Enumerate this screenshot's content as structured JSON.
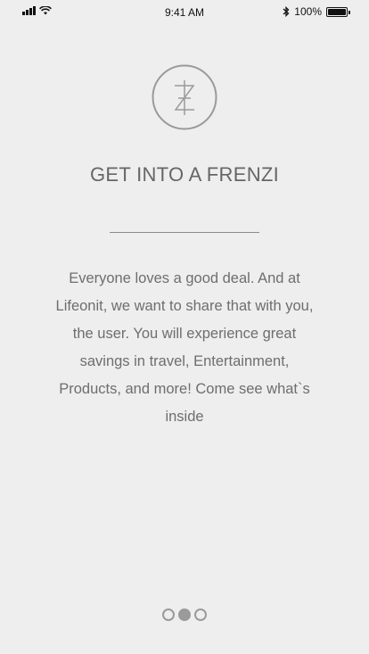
{
  "status_bar": {
    "time": "9:41 AM",
    "battery_text": "100%",
    "icons": [
      "signal-icon",
      "wifi-icon",
      "bluetooth-icon",
      "battery-icon"
    ]
  },
  "logo": {
    "icon": "frenzi-logo-icon",
    "color": "#9a9a9a"
  },
  "title": "GET INTO A FRENZI",
  "body": "Everyone loves a good deal. And at Lifeonit, we want to share that with you, the user. You will experience great savings in travel, Entertainment, Products, and more! Come see what`s inside",
  "pager": {
    "pages": 3,
    "current": 2
  }
}
